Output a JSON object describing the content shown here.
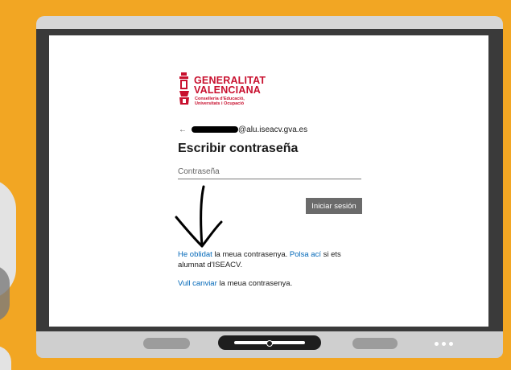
{
  "brand": {
    "title_line1": "GENERALITAT",
    "title_line2": "VALENCIANA",
    "sub_line1": "Conselleria d'Educació,",
    "sub_line2": "Universitats i Ocupació",
    "color": "#c8102e"
  },
  "login": {
    "email_suffix": "@alu.iseacv.gva.es",
    "heading": "Escribir contraseña",
    "password_placeholder": "Contraseña",
    "signin_label": "Iniciar sesión"
  },
  "help": {
    "forgot_link": "He oblidat",
    "forgot_text": " la meua contrasenya. ",
    "click_link": "Polsa ací",
    "click_text": " si ets alumnat d'ISEACV.",
    "change_link": "Vull canviar",
    "change_text": " la meua contrasenya."
  },
  "colors": {
    "link": "#0067b8",
    "button": "#6b6b6b",
    "background": "#f2a623"
  },
  "icons": {
    "back": "back-arrow-icon",
    "annotation": "hand-drawn-down-arrow"
  }
}
